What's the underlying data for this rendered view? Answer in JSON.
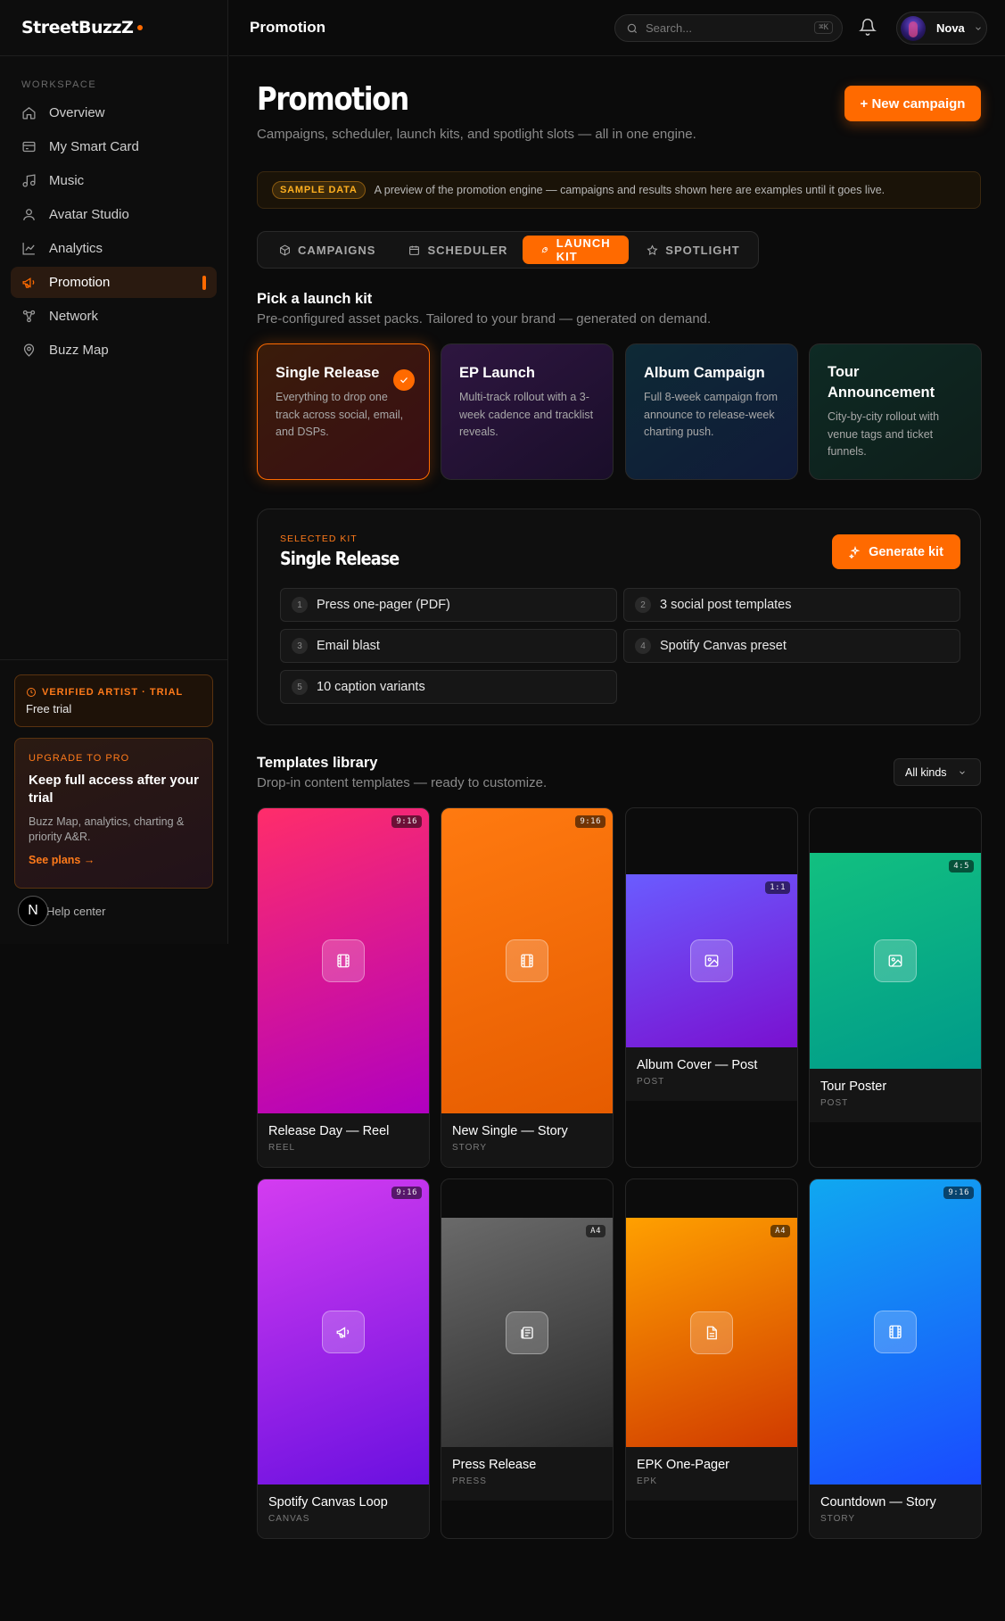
{
  "brand": {
    "name": "StreetBuzzZ",
    "accent": "#ff6a00"
  },
  "sidebar": {
    "section_label": "WORKSPACE",
    "items": [
      {
        "label": "Overview",
        "icon": "home-icon"
      },
      {
        "label": "My Smart Card",
        "icon": "card-icon"
      },
      {
        "label": "Music",
        "icon": "music-note-icon"
      },
      {
        "label": "Avatar Studio",
        "icon": "user-icon"
      },
      {
        "label": "Analytics",
        "icon": "line-chart-icon"
      },
      {
        "label": "Promotion",
        "icon": "megaphone-icon",
        "active": true
      },
      {
        "label": "Network",
        "icon": "network-icon"
      },
      {
        "label": "Buzz Map",
        "icon": "map-pin-icon"
      }
    ],
    "trial": {
      "title": "VERIFIED ARTIST · TRIAL",
      "subtitle": "Free trial"
    },
    "upgrade": {
      "kicker": "UPGRADE TO PRO",
      "title": "Keep full access after your trial",
      "description": "Buzz Map, analytics, charting & priority A&R.",
      "link": "See plans →"
    },
    "help": {
      "badge": "N",
      "label": "Help center"
    }
  },
  "topbar": {
    "title": "Promotion",
    "search_placeholder": "Search...",
    "search_shortcut": "⌘K",
    "user_name": "Nova"
  },
  "page": {
    "title": "Promotion",
    "subtitle": "Campaigns, scheduler, launch kits, and spotlight slots — all in one engine.",
    "new_campaign": "+ New campaign",
    "sample": {
      "badge": "SAMPLE DATA",
      "text": "A preview of the promotion engine — campaigns and results shown here are examples until it goes live."
    },
    "tabs": [
      {
        "label": "CAMPAIGNS",
        "icon": "cube-icon"
      },
      {
        "label": "SCHEDULER",
        "icon": "calendar-icon"
      },
      {
        "label": "LAUNCH KIT",
        "icon": "rocket-icon",
        "active": true
      },
      {
        "label": "SPOTLIGHT",
        "icon": "star-icon"
      }
    ]
  },
  "launch_kit": {
    "title": "Pick a launch kit",
    "subtitle": "Pre-configured asset packs. Tailored to your brand — generated on demand.",
    "kits": [
      {
        "title": "Single Release",
        "description": "Everything to drop one track across social, email, and DSPs.",
        "selected": true
      },
      {
        "title": "EP Launch",
        "description": "Multi-track rollout with a 3-week cadence and tracklist reveals."
      },
      {
        "title": "Album Campaign",
        "description": "Full 8-week campaign from announce to release-week charting push."
      },
      {
        "title": "Tour Announcement",
        "description": "City-by-city rollout with venue tags and ticket funnels."
      }
    ],
    "selected": {
      "kicker": "SELECTED KIT",
      "title": "Single Release",
      "generate_label": "Generate kit",
      "assets": [
        {
          "num": "1",
          "label": "Press one-pager (PDF)"
        },
        {
          "num": "2",
          "label": "3 social post templates"
        },
        {
          "num": "3",
          "label": "Email blast"
        },
        {
          "num": "4",
          "label": "Spotify Canvas preset"
        },
        {
          "num": "5",
          "label": "10 caption variants"
        }
      ]
    }
  },
  "templates": {
    "title": "Templates library",
    "subtitle": "Drop-in content templates — ready to customize.",
    "filter": "All kinds",
    "items": [
      {
        "name": "Release Day — Reel",
        "kind": "REEL",
        "ratio": "9:16",
        "icon": "film-icon",
        "colors": [
          "#ff2d6a",
          "#b000c0"
        ]
      },
      {
        "name": "New Single — Story",
        "kind": "STORY",
        "ratio": "9:16",
        "icon": "film-icon",
        "colors": [
          "#ff7a10",
          "#e65c00"
        ]
      },
      {
        "name": "Album Cover — Post",
        "kind": "POST",
        "ratio": "1:1",
        "icon": "image-icon",
        "colors": [
          "#6a5cff",
          "#7a10d0"
        ]
      },
      {
        "name": "Tour Poster",
        "kind": "POST",
        "ratio": "4:5",
        "icon": "image-icon",
        "colors": [
          "#12c080",
          "#009a8a"
        ]
      },
      {
        "name": "Spotify Canvas Loop",
        "kind": "CANVAS",
        "ratio": "9:16",
        "icon": "megaphone-icon",
        "colors": [
          "#d43cf0",
          "#6a10e0"
        ]
      },
      {
        "name": "Press Release",
        "kind": "PRESS",
        "ratio": "A4",
        "icon": "newspaper-icon",
        "colors": [
          "#6a6a6a",
          "#2a2a2a"
        ]
      },
      {
        "name": "EPK One-Pager",
        "kind": "EPK",
        "ratio": "A4",
        "icon": "document-icon",
        "colors": [
          "#ffa000",
          "#d03a00"
        ]
      },
      {
        "name": "Countdown — Story",
        "kind": "STORY",
        "ratio": "9:16",
        "icon": "film-icon",
        "colors": [
          "#10a8f0",
          "#1a4aff"
        ]
      }
    ]
  }
}
